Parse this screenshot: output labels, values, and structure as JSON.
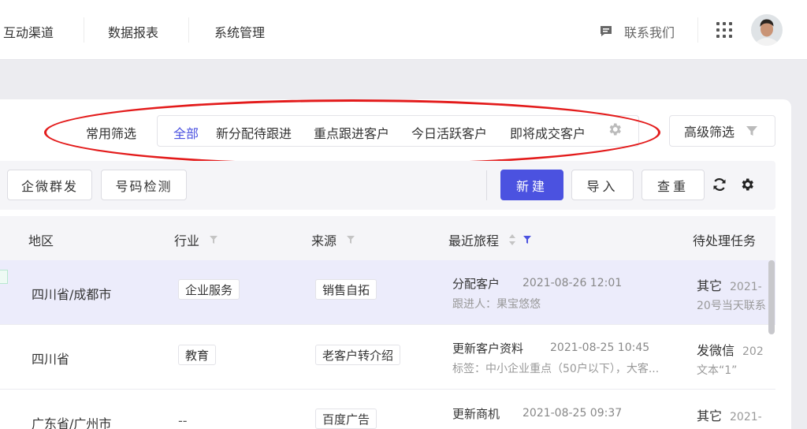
{
  "nav": {
    "items": [
      "互动渠道",
      "数据报表",
      "系统管理"
    ],
    "contact_label": "联系我们"
  },
  "filters": {
    "label": "常用筛选",
    "chips": [
      "全部",
      "新分配待跟进",
      "重点跟进客户",
      "今日活跃客户",
      "即将成交客户"
    ],
    "active_index": 0,
    "advanced_label": "高级筛选"
  },
  "toolbar": {
    "left_buttons": [
      "企微群发",
      "号码检测"
    ],
    "new_label": "新建",
    "import_label": "导入",
    "dedupe_label": "查重"
  },
  "table": {
    "columns": [
      "地区",
      "行业",
      "来源",
      "最近旅程",
      "待处理任务"
    ],
    "rows": [
      {
        "region": "四川省/成都市",
        "industry": "企业服务",
        "source": "销售自拓",
        "journey_title": "分配客户",
        "journey_time": "2021-08-26 12:01",
        "journey_sub": "跟进人：果宝悠悠",
        "task_title": "其它",
        "task_time": "2021-",
        "task_sub": "20号当天联系"
      },
      {
        "region": "四川省",
        "industry": "教育",
        "source": "老客户转介绍",
        "journey_title": "更新客户资料",
        "journey_time": "2021-08-25 10:45",
        "journey_sub": "标签：中小企业重点（50户以下），大客...",
        "task_title": "发微信",
        "task_time": "202",
        "task_sub": "文本“1”"
      },
      {
        "region": "广东省/广州市",
        "industry": "--",
        "source": "百度广告",
        "journey_title": "更新商机",
        "journey_time": "2021-08-25 09:37",
        "journey_sub": "",
        "task_title": "其它",
        "task_time": "2021-",
        "task_sub": ""
      }
    ]
  },
  "colors": {
    "primary": "#4b52e0",
    "annotation": "#e31b1b",
    "selected_row": "#ececfb"
  }
}
